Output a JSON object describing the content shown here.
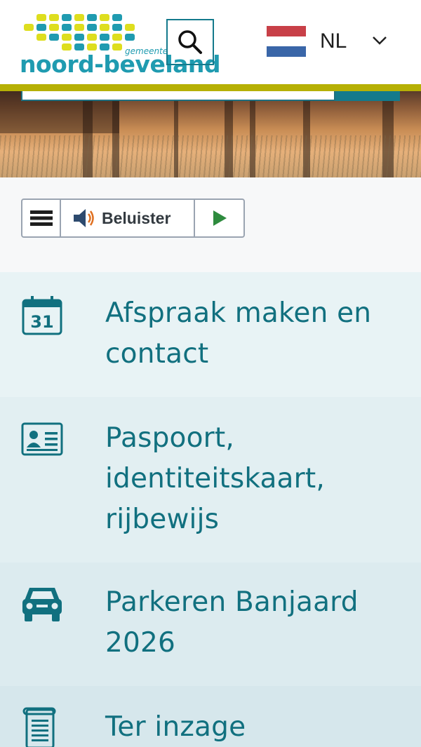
{
  "header": {
    "logo": {
      "name": "noord-beveland",
      "small": "gemeente"
    },
    "search_icon": "search-icon",
    "language": {
      "code": "NL",
      "flag_colors": [
        "#c84048",
        "#ffffff",
        "#3a66a8"
      ]
    },
    "colors": {
      "accent": "#b6b005",
      "brand": "#147a8c"
    }
  },
  "readspeaker": {
    "menu_icon": "menu-icon",
    "speaker_icon": "speaker-icon",
    "listen_label": "Beluister",
    "play_icon": "play-icon",
    "play_color": "#2e8b3e"
  },
  "tiles": [
    {
      "icon": "calendar-icon",
      "label": "Afspraak maken en contact",
      "calendar_day": "31",
      "bg": "#e8f3f5"
    },
    {
      "icon": "id-card-icon",
      "label": "Paspoort, identiteitskaart, rijbewijs",
      "bg": "#e2eff2"
    },
    {
      "icon": "car-icon",
      "label": "Parkeren Banjaard 2026",
      "bg": "#dcebef"
    },
    {
      "icon": "document-icon",
      "label": "Ter inzage",
      "bg": "#d6e7ec"
    }
  ]
}
